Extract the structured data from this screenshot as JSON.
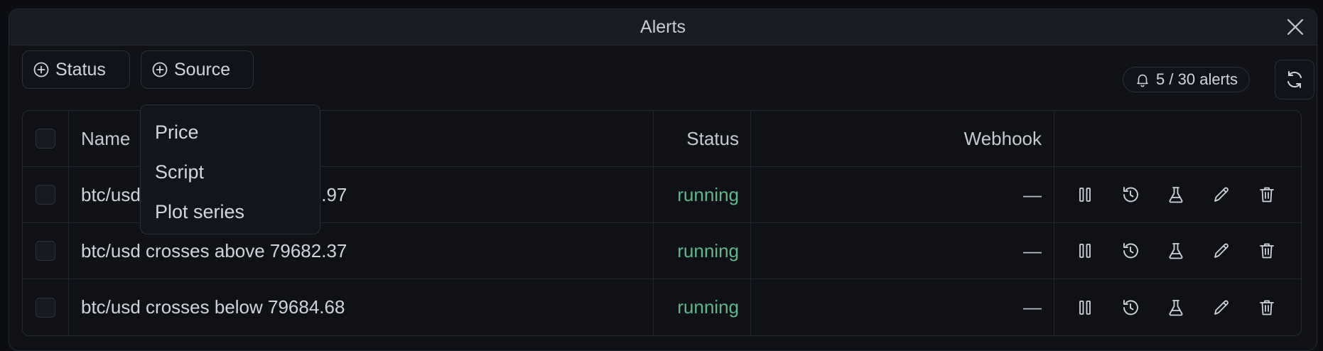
{
  "dialog": {
    "title": "Alerts"
  },
  "filters": {
    "status_label": "Status",
    "source_label": "Source"
  },
  "alerts_count": "5 / 30 alerts",
  "source_menu": {
    "items": [
      "Price",
      "Script",
      "Plot series"
    ]
  },
  "table": {
    "headers": {
      "name": "Name",
      "status": "Status",
      "webhook": "Webhook"
    },
    "rows": [
      {
        "name": "btc/usd crosses above 80892.97",
        "status": "running",
        "webhook": "—"
      },
      {
        "name": "btc/usd crosses above 79682.37",
        "status": "running",
        "webhook": "—"
      },
      {
        "name": "btc/usd crosses below 79684.68",
        "status": "running",
        "webhook": "—"
      }
    ]
  },
  "colors": {
    "running": "#5fb88a",
    "background": "#0f1117",
    "titlebar": "#191c23"
  },
  "icons": {
    "close": "close-icon",
    "filter": "plus-circle-icon",
    "bell": "bell-icon",
    "refresh": "refresh-icon",
    "pause": "pause-icon",
    "history": "history-icon",
    "test": "flask-icon",
    "edit": "pencil-icon",
    "delete": "trash-icon"
  }
}
